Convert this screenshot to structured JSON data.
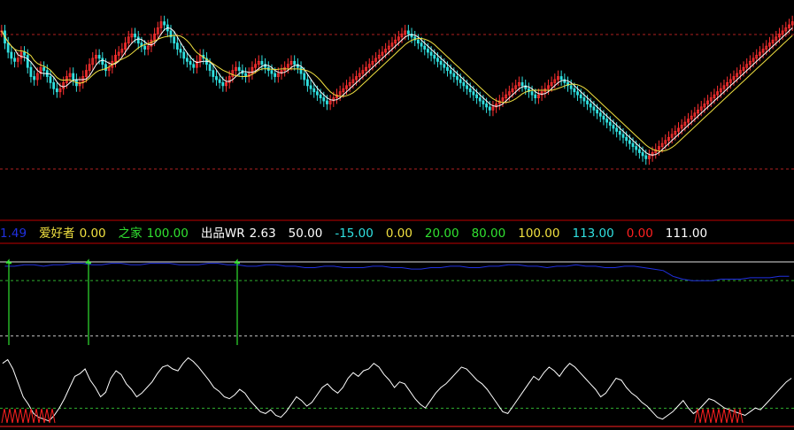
{
  "colors": {
    "background": "#000000",
    "up_candle": "#ff3030",
    "down_candle": "#30e0e0",
    "ma_white": "#ffffff",
    "ma_yellow": "#f0e040",
    "grid_red": "#b02020",
    "panel_border": "#c00000",
    "blue_line": "#2030e0",
    "green_spike": "#30e030",
    "wr_line": "#ffffff",
    "dashed_white": "#c8c8c8",
    "dashed_green": "#30b030",
    "bottom_red": "#ff2020"
  },
  "legend": {
    "items": [
      {
        "text": "1.49",
        "color": "#2030e0"
      },
      {
        "text": "爱好者",
        "color": "#f0e040",
        "tight": true
      },
      {
        "text": "0.00",
        "color": "#f0e040"
      },
      {
        "text": "之家",
        "color": "#30e030",
        "tight": true
      },
      {
        "text": "100.00",
        "color": "#30e030"
      },
      {
        "text": "出品WR",
        "color": "#ffffff",
        "tight": true
      },
      {
        "text": "2.63",
        "color": "#ffffff"
      },
      {
        "text": "50.00",
        "color": "#ffffff"
      },
      {
        "text": "-15.00",
        "color": "#30e0e0"
      },
      {
        "text": "0.00",
        "color": "#f0e040"
      },
      {
        "text": "20.00",
        "color": "#30e030"
      },
      {
        "text": "80.00",
        "color": "#30e030"
      },
      {
        "text": "100.00",
        "color": "#f0e040"
      },
      {
        "text": "113.00",
        "color": "#30e0e0"
      },
      {
        "text": "0.00",
        "color": "#ff2020"
      },
      {
        "text": "111.00",
        "color": "#ffffff"
      }
    ]
  },
  "chart_data": [
    {
      "type": "line",
      "panel": "price",
      "series": [
        {
          "close": [
            62,
            58,
            55,
            53,
            52,
            53,
            55,
            54,
            50,
            47,
            46,
            48,
            50,
            49,
            47,
            45,
            43,
            42,
            43,
            45,
            47,
            48,
            46,
            44,
            45,
            47,
            49,
            51,
            53,
            54,
            53,
            51,
            49,
            50,
            52,
            54,
            55,
            56,
            58,
            60,
            61,
            60,
            58,
            57,
            56,
            57,
            59,
            61,
            63,
            65,
            64,
            62,
            60,
            58,
            56,
            55,
            53,
            52,
            51,
            50,
            52,
            54,
            53,
            51,
            49,
            47,
            46,
            45,
            44,
            45,
            47,
            49,
            50,
            49,
            48,
            47,
            48,
            50,
            51,
            52,
            51,
            50,
            49,
            48,
            47,
            48,
            49,
            50,
            51,
            52,
            51,
            50,
            48,
            46,
            44,
            43,
            42,
            41,
            40,
            39,
            38,
            39,
            40,
            41,
            42,
            43,
            44,
            45,
            46,
            47,
            48,
            49,
            50,
            51,
            52,
            53,
            54,
            55,
            56,
            57,
            58,
            59,
            60,
            61,
            62,
            61,
            60,
            59,
            58,
            57,
            56,
            55,
            54,
            53,
            52,
            51,
            50,
            49,
            48,
            47,
            46,
            45,
            44,
            43,
            42,
            41,
            40,
            39,
            38,
            37,
            36,
            37,
            38,
            39,
            40,
            41,
            42,
            43,
            44,
            45,
            44,
            43,
            42,
            41,
            40,
            41,
            42,
            43,
            44,
            45,
            46,
            47,
            46,
            45,
            44,
            43,
            42,
            41,
            40,
            39,
            38,
            37,
            36,
            35,
            34,
            33,
            32,
            31,
            30,
            29,
            28,
            27,
            26,
            25,
            24,
            23,
            22,
            21,
            20,
            21,
            22,
            23,
            24,
            25,
            26,
            27,
            28,
            29,
            30,
            31,
            32,
            33,
            34,
            35,
            36,
            37,
            38,
            39,
            40,
            41,
            42,
            43,
            44,
            45,
            46,
            47,
            48,
            49,
            50,
            51,
            52,
            53,
            54,
            55,
            56,
            57,
            58,
            59,
            60,
            61,
            62,
            63,
            64,
            65
          ]
        }
      ]
    },
    {
      "type": "line",
      "panel": "indicator",
      "hlines": [
        0,
        20,
        80,
        100,
        113
      ],
      "series": [
        {
          "name": "1.49",
          "values": [
            110,
            110,
            111,
            111,
            110,
            111,
            111,
            112,
            112,
            111,
            111,
            112,
            112,
            111,
            111,
            112,
            112,
            112,
            111,
            111,
            111,
            112,
            112,
            111,
            111,
            110,
            110,
            111,
            111,
            110,
            110,
            109,
            109,
            110,
            110,
            109,
            109,
            109,
            110,
            110,
            109,
            109,
            108,
            108,
            109,
            109,
            110,
            110,
            109,
            109,
            110,
            110,
            111,
            111,
            110,
            110,
            109,
            110,
            110,
            111,
            110,
            110,
            109,
            109,
            110,
            110,
            109,
            108,
            107,
            103,
            101,
            100,
            100,
            100,
            101,
            101,
            101,
            102,
            102,
            102,
            103,
            103
          ]
        },
        {
          "name": "WR",
          "values": [
            66,
            70,
            60,
            45,
            30,
            22,
            12,
            8,
            6,
            4,
            10,
            18,
            28,
            40,
            52,
            55,
            60,
            48,
            40,
            30,
            35,
            50,
            58,
            54,
            44,
            38,
            30,
            34,
            40,
            46,
            55,
            62,
            64,
            60,
            58,
            66,
            72,
            68,
            62,
            55,
            48,
            40,
            36,
            30,
            28,
            32,
            38,
            34,
            26,
            20,
            14,
            12,
            16,
            10,
            8,
            14,
            22,
            30,
            26,
            20,
            24,
            32,
            40,
            44,
            38,
            34,
            40,
            50,
            56,
            52,
            58,
            60,
            66,
            62,
            54,
            48,
            40,
            46,
            44,
            36,
            28,
            22,
            18,
            26,
            34,
            40,
            44,
            50,
            56,
            62,
            60,
            54,
            48,
            44,
            38,
            30,
            22,
            14,
            12,
            20,
            28,
            36,
            44,
            52,
            48,
            56,
            62,
            58,
            52,
            60,
            66,
            62,
            56,
            50,
            44,
            38,
            30,
            34,
            42,
            50,
            48,
            40,
            34,
            30,
            24,
            20,
            14,
            8,
            6,
            10,
            14,
            20,
            26,
            18,
            12,
            16,
            22,
            28,
            26,
            22,
            18,
            16,
            14,
            12,
            10,
            14,
            18,
            16,
            22,
            28,
            34,
            40,
            46,
            50
          ]
        }
      ]
    }
  ]
}
